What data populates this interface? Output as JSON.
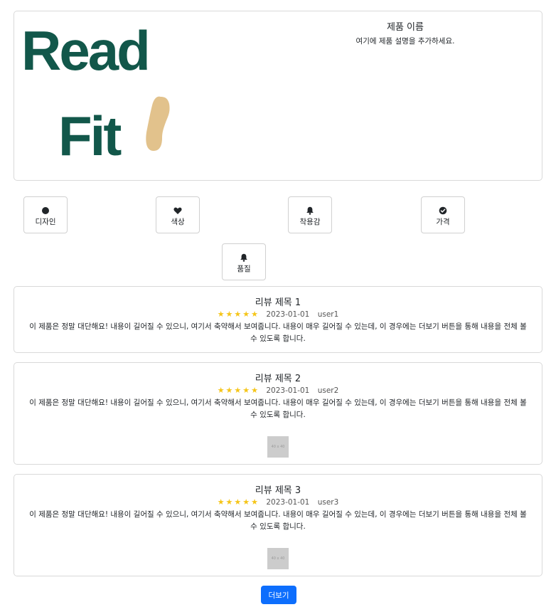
{
  "product": {
    "logo_line1": "Read",
    "logo_line2": "Fit",
    "name": "제품 이름",
    "description": "여기에 제품 설명을 추가하세요."
  },
  "features": [
    {
      "label": "디자인",
      "icon": "circle-icon"
    },
    {
      "label": "색상",
      "icon": "heart-icon"
    },
    {
      "label": "착용감",
      "icon": "bell-icon"
    },
    {
      "label": "가격",
      "icon": "check-circle-icon"
    },
    {
      "label": "품질",
      "icon": "bell-icon"
    }
  ],
  "reviews": [
    {
      "title": "리뷰 제목 1",
      "rating": 5,
      "stars": "★★★★★",
      "date": "2023-01-01",
      "user": "user1",
      "body": "이 제품은 정말 대단해요! 내용이 길어질 수 있으니, 여기서 축약해서 보여줍니다. 내용이 매우 길어질 수 있는데, 이 경우에는 더보기 버튼을 통해 내용을 전체 볼 수 있도록 합니다."
    },
    {
      "title": "리뷰 제목 2",
      "rating": 5,
      "stars": "★★★★★",
      "date": "2023-01-01",
      "user": "user2",
      "body": "이 제품은 정말 대단해요! 내용이 길어질 수 있으니, 여기서 축약해서 보여줍니다. 내용이 매우 길어질 수 있는데, 이 경우에는 더보기 버튼을 통해 내용을 전체 볼 수 있도록 합니다.",
      "image_label": "40 x 40"
    },
    {
      "title": "리뷰 제목 3",
      "rating": 5,
      "stars": "★★★★★",
      "date": "2023-01-01",
      "user": "user3",
      "body": "이 제품은 정말 대단해요! 내용이 길어질 수 있으니, 여기서 축약해서 보여줍니다. 내용이 매우 길어질 수 있는데, 이 경우에는 더보기 버튼을 통해 내용을 전체 볼 수 있도록 합니다.",
      "image_label": "40 x 40"
    }
  ],
  "more_button": "더보기",
  "colors": {
    "logo_green": "#12574a",
    "logo_tan": "#e2c28c",
    "star": "#f5c518",
    "primary": "#0d6efd",
    "border": "#d9d9d9"
  }
}
